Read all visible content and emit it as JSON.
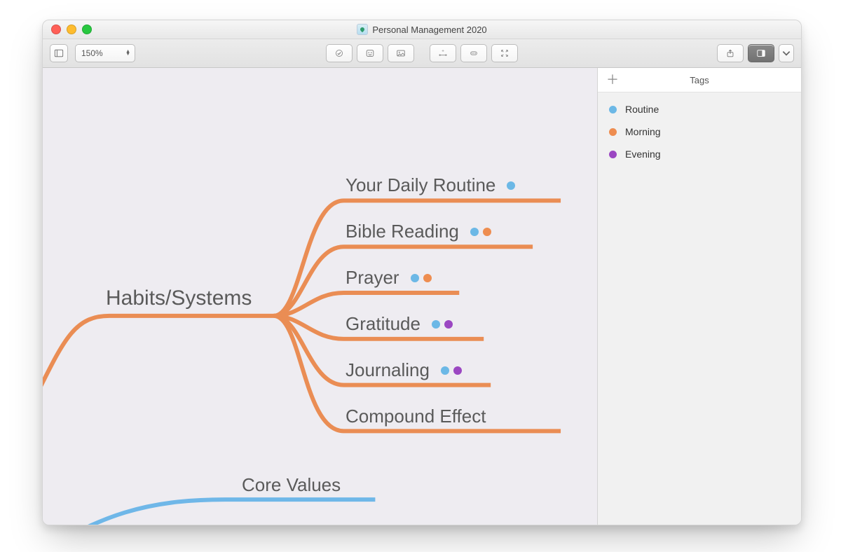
{
  "window": {
    "title": "Personal Management 2020"
  },
  "toolbar": {
    "zoom": "150%"
  },
  "canvas": {
    "root": "Habits/Systems",
    "children": [
      {
        "label": "Your Daily Routine",
        "tags": [
          "routine"
        ]
      },
      {
        "label": "Bible Reading",
        "tags": [
          "routine",
          "morning"
        ]
      },
      {
        "label": "Prayer",
        "tags": [
          "routine",
          "morning"
        ]
      },
      {
        "label": "Gratitude",
        "tags": [
          "routine",
          "evening"
        ]
      },
      {
        "label": "Journaling",
        "tags": [
          "routine",
          "evening"
        ]
      },
      {
        "label": "Compound Effect",
        "tags": []
      }
    ],
    "siblings": [
      {
        "label": "Core Values",
        "color": "blue"
      }
    ]
  },
  "panel": {
    "title": "Tags",
    "tags": [
      {
        "id": "routine",
        "label": "Routine",
        "color": "#6cb8e6"
      },
      {
        "id": "morning",
        "label": "Morning",
        "color": "#ee8d50"
      },
      {
        "id": "evening",
        "label": "Evening",
        "color": "#9b47c2"
      }
    ]
  }
}
